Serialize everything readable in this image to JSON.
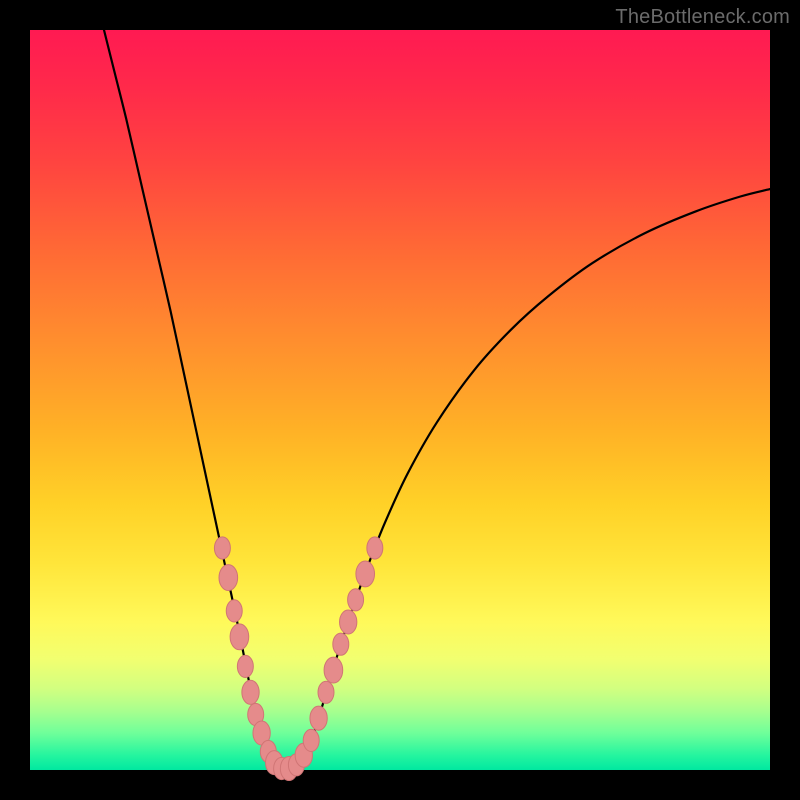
{
  "watermark": {
    "text": "TheBottleneck.com"
  },
  "colors": {
    "curve_stroke": "#000000",
    "marker_fill": "#e58b8b",
    "marker_stroke": "#d07575"
  },
  "chart_data": {
    "type": "line",
    "title": "",
    "xlabel": "",
    "ylabel": "",
    "xlim": [
      0,
      100
    ],
    "ylim": [
      0,
      100
    ],
    "curve": [
      {
        "x": 10.0,
        "y": 100.0
      },
      {
        "x": 11.5,
        "y": 94.0
      },
      {
        "x": 13.0,
        "y": 88.0
      },
      {
        "x": 14.5,
        "y": 81.5
      },
      {
        "x": 16.0,
        "y": 75.0
      },
      {
        "x": 17.5,
        "y": 68.5
      },
      {
        "x": 19.0,
        "y": 62.0
      },
      {
        "x": 20.5,
        "y": 55.0
      },
      {
        "x": 22.0,
        "y": 48.0
      },
      {
        "x": 23.5,
        "y": 41.0
      },
      {
        "x": 25.0,
        "y": 34.0
      },
      {
        "x": 26.5,
        "y": 27.0
      },
      {
        "x": 28.0,
        "y": 20.0
      },
      {
        "x": 29.0,
        "y": 15.0
      },
      {
        "x": 30.0,
        "y": 10.0
      },
      {
        "x": 31.0,
        "y": 6.0
      },
      {
        "x": 32.0,
        "y": 3.0
      },
      {
        "x": 33.0,
        "y": 1.0
      },
      {
        "x": 34.0,
        "y": 0.0
      },
      {
        "x": 35.0,
        "y": 0.0
      },
      {
        "x": 36.0,
        "y": 0.5
      },
      {
        "x": 37.0,
        "y": 2.0
      },
      {
        "x": 38.0,
        "y": 4.0
      },
      {
        "x": 39.0,
        "y": 7.0
      },
      {
        "x": 40.5,
        "y": 12.0
      },
      {
        "x": 42.0,
        "y": 17.0
      },
      {
        "x": 44.0,
        "y": 23.0
      },
      {
        "x": 46.0,
        "y": 28.5
      },
      {
        "x": 48.0,
        "y": 33.5
      },
      {
        "x": 51.0,
        "y": 40.0
      },
      {
        "x": 55.0,
        "y": 47.0
      },
      {
        "x": 60.0,
        "y": 54.0
      },
      {
        "x": 65.0,
        "y": 59.5
      },
      {
        "x": 70.0,
        "y": 64.0
      },
      {
        "x": 76.0,
        "y": 68.5
      },
      {
        "x": 83.0,
        "y": 72.5
      },
      {
        "x": 90.0,
        "y": 75.5
      },
      {
        "x": 96.0,
        "y": 77.5
      },
      {
        "x": 100.0,
        "y": 78.5
      }
    ],
    "markers": [
      {
        "x": 26.0,
        "y": 30.0,
        "r": 1.2
      },
      {
        "x": 26.8,
        "y": 26.0,
        "r": 1.4
      },
      {
        "x": 27.6,
        "y": 21.5,
        "r": 1.2
      },
      {
        "x": 28.3,
        "y": 18.0,
        "r": 1.4
      },
      {
        "x": 29.1,
        "y": 14.0,
        "r": 1.2
      },
      {
        "x": 29.8,
        "y": 10.5,
        "r": 1.3
      },
      {
        "x": 30.5,
        "y": 7.5,
        "r": 1.2
      },
      {
        "x": 31.3,
        "y": 5.0,
        "r": 1.3
      },
      {
        "x": 32.2,
        "y": 2.5,
        "r": 1.2
      },
      {
        "x": 33.0,
        "y": 1.0,
        "r": 1.3
      },
      {
        "x": 34.0,
        "y": 0.2,
        "r": 1.2
      },
      {
        "x": 35.0,
        "y": 0.2,
        "r": 1.3
      },
      {
        "x": 36.0,
        "y": 0.7,
        "r": 1.2
      },
      {
        "x": 37.0,
        "y": 2.0,
        "r": 1.3
      },
      {
        "x": 38.0,
        "y": 4.0,
        "r": 1.2
      },
      {
        "x": 39.0,
        "y": 7.0,
        "r": 1.3
      },
      {
        "x": 40.0,
        "y": 10.5,
        "r": 1.2
      },
      {
        "x": 41.0,
        "y": 13.5,
        "r": 1.4
      },
      {
        "x": 42.0,
        "y": 17.0,
        "r": 1.2
      },
      {
        "x": 43.0,
        "y": 20.0,
        "r": 1.3
      },
      {
        "x": 44.0,
        "y": 23.0,
        "r": 1.2
      },
      {
        "x": 45.3,
        "y": 26.5,
        "r": 1.4
      },
      {
        "x": 46.6,
        "y": 30.0,
        "r": 1.2
      }
    ]
  }
}
